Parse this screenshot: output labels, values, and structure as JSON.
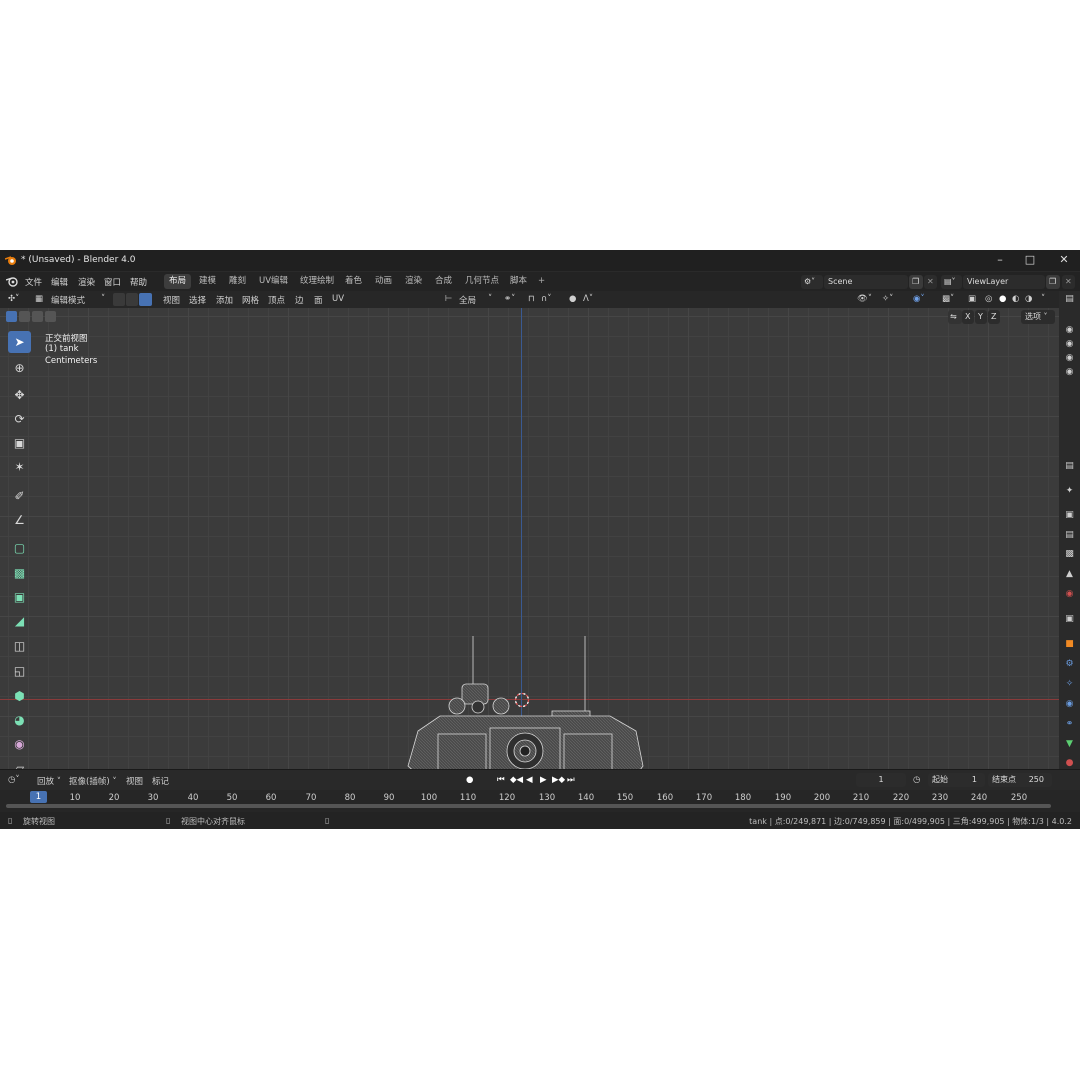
{
  "window": {
    "title": "* (Unsaved) - Blender 4.0",
    "controls": [
      "minimize",
      "maximize",
      "close"
    ]
  },
  "menu": {
    "items": [
      "文件",
      "编辑",
      "渲染",
      "窗口",
      "帮助"
    ],
    "workspaces": [
      "布局",
      "建模",
      "雕刻",
      "UV编辑",
      "纹理绘制",
      "着色",
      "动画",
      "渲染",
      "合成",
      "几何节点",
      "脚本"
    ],
    "active_workspace": "布局",
    "add_label": "+",
    "scene": "Scene",
    "view_layer": "ViewLayer"
  },
  "viewport_header": {
    "mode": "编辑模式",
    "menus": [
      "视图",
      "选择",
      "添加",
      "网格",
      "顶点",
      "边",
      "面",
      "UV"
    ],
    "transform_orientation": "全局",
    "axes": [
      "X",
      "Y",
      "Z"
    ],
    "options": "选项"
  },
  "viewport": {
    "view_name": "正交前视图",
    "object": "(1) tank",
    "units": "Centimeters"
  },
  "timeline": {
    "menus": [
      "回放",
      "抠像(插帧)",
      "视图",
      "标记"
    ],
    "current_frame": "1",
    "start_label": "起始",
    "start_value": "1",
    "end_label": "结束点",
    "end_value": "250",
    "frame_marker": "1",
    "ruler": [
      "10",
      "20",
      "30",
      "40",
      "50",
      "60",
      "70",
      "80",
      "90",
      "100",
      "110",
      "120",
      "130",
      "140",
      "150",
      "160",
      "170",
      "180",
      "190",
      "200",
      "210",
      "220",
      "230",
      "240",
      "250"
    ]
  },
  "status": {
    "left_hint": "旋转视图",
    "mid_hint": "视图中心对齐鼠标",
    "stats": "tank | 点:0/249,871 | 边:0/749,859 | 面:0/499,905 | 三角:499,905 | 物体:1/3 | 4.0.2"
  },
  "colors": {
    "accent": "#4772b3",
    "viewport_bg": "#3b3b3b",
    "x_axis": "#8a3b3b",
    "y_axis": "#3a5a92"
  }
}
